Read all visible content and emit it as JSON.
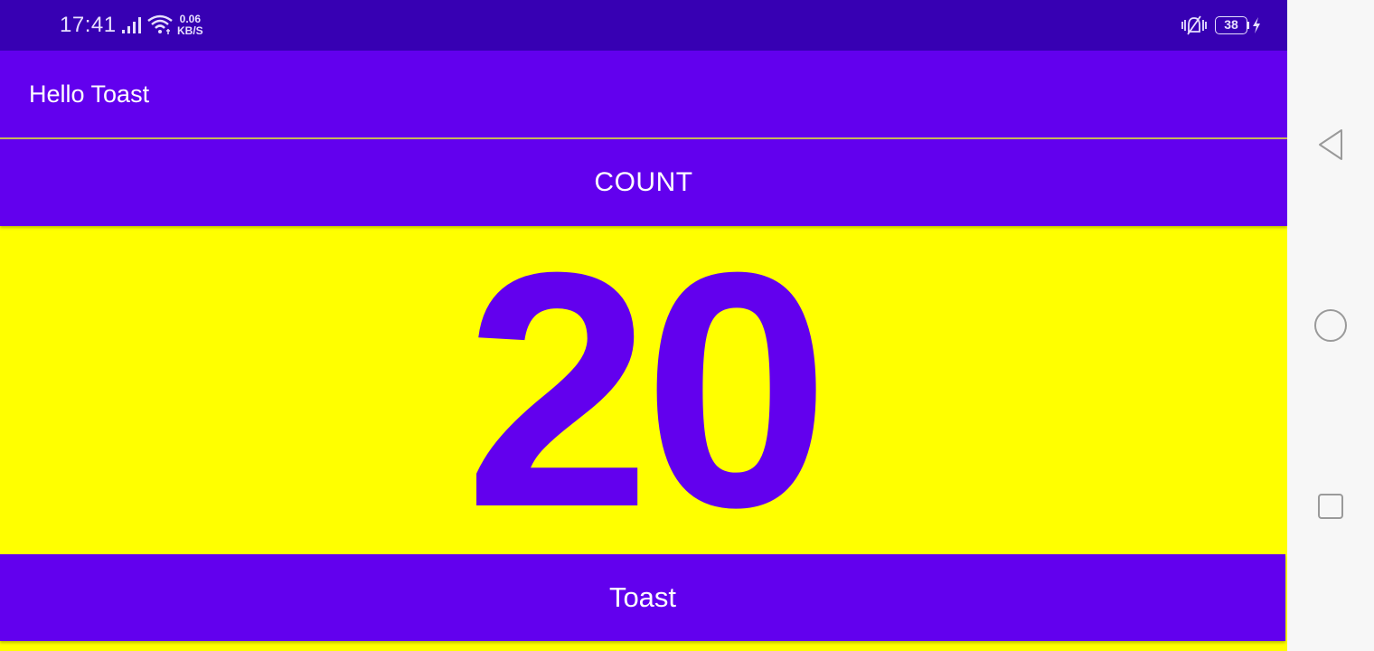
{
  "status_bar": {
    "time": "17:41",
    "net_speed_value": "0.06",
    "net_speed_unit": "KB/S",
    "battery_level": "38",
    "icons": [
      "signal-icon",
      "wifi-icon",
      "vibrate-icon",
      "battery-icon",
      "charging-icon"
    ]
  },
  "app_bar": {
    "title": "Hello Toast"
  },
  "main": {
    "count_button_label": "COUNT",
    "count_value": "20",
    "toast_button_label": "Toast"
  },
  "nav_bar": {
    "icons": [
      "back-icon",
      "home-icon",
      "recents-icon"
    ]
  },
  "colors": {
    "primary": "#6200EE",
    "primary_dark": "#3700B3",
    "background": "#FFFF00",
    "on_primary": "#FFFFFF",
    "nav_bar": "#F7F7F7"
  }
}
